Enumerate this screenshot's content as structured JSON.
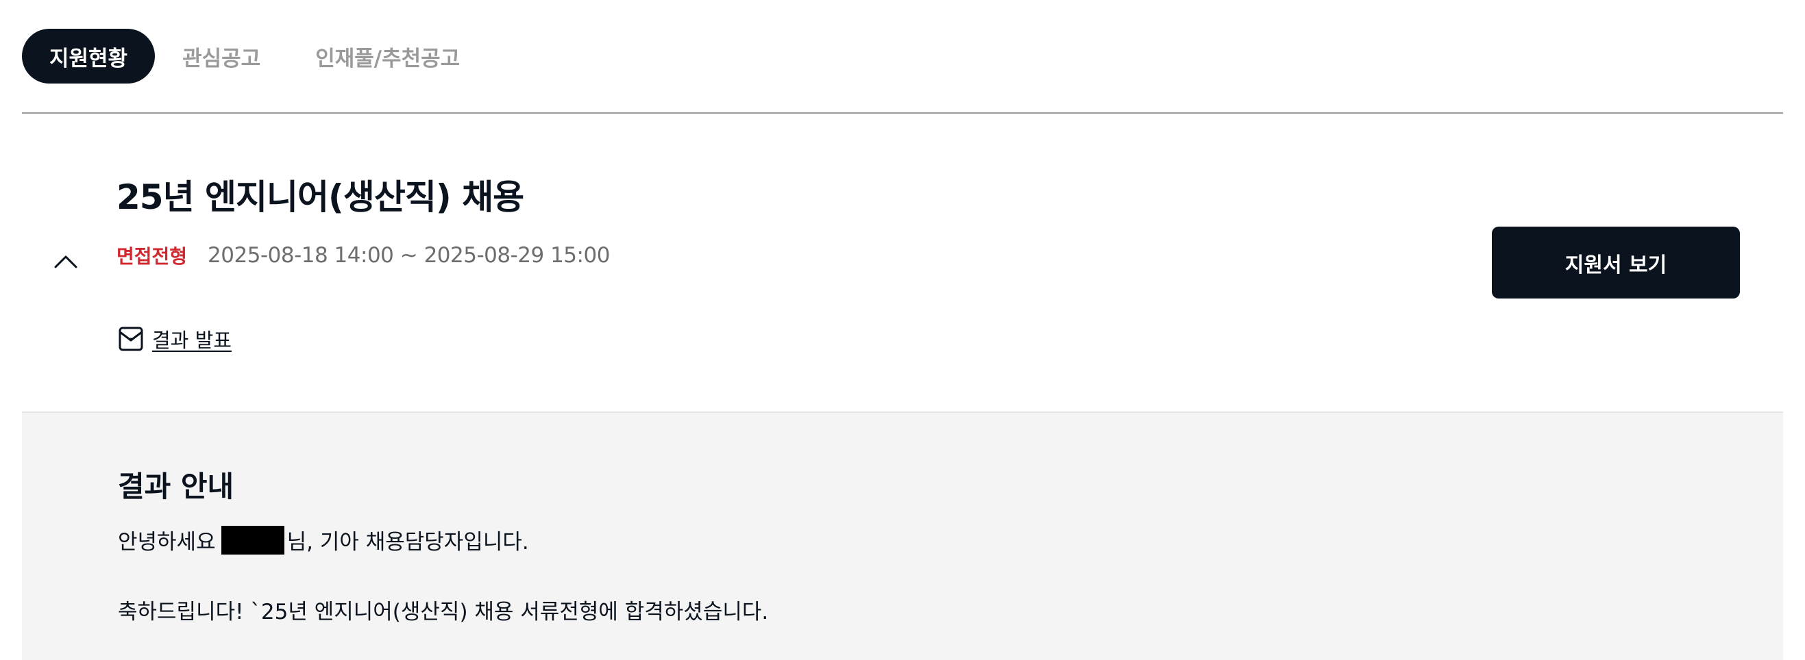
{
  "tabs": [
    {
      "label": "지원현황",
      "active": true
    },
    {
      "label": "관심공고",
      "active": false
    },
    {
      "label": "인재풀/추천공고",
      "active": false
    }
  ],
  "job": {
    "title": "25년 엔지니어(생산직) 채용",
    "status": "면접전형",
    "period": "2025-08-18 14:00 ~ 2025-08-29 15:00",
    "result_link_label": "결과 발표",
    "view_button_label": "지원서 보기",
    "collapse_icon": "chevron-up-icon",
    "mail_icon": "mail-icon"
  },
  "result": {
    "heading": "결과 안내",
    "greeting_prefix": "안녕하세요",
    "greeting_suffix": "님, 기아 채용담당자입니다.",
    "message": "축하드립니다! `25년 엔지니어(생산직) 채용 서류전형에 합격하셨습니다."
  },
  "colors": {
    "primary": "#0b141e",
    "status_red": "#d12830",
    "muted": "#9a9a9a",
    "panel_bg": "#f4f4f4"
  }
}
